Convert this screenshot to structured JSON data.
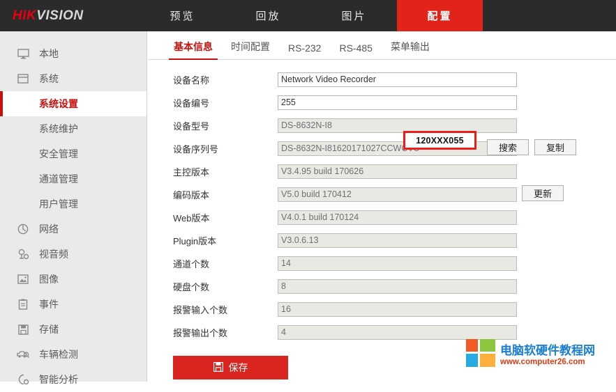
{
  "header": {
    "logo_hik": "HIK",
    "logo_vision": "VISION",
    "nav": [
      {
        "label": "预览",
        "name": "nav-preview",
        "active": false
      },
      {
        "label": "回放",
        "name": "nav-playback",
        "active": false
      },
      {
        "label": "图片",
        "name": "nav-picture",
        "active": false
      },
      {
        "label": "配置",
        "name": "nav-configuration",
        "active": true
      }
    ]
  },
  "sidebar": {
    "items": [
      {
        "label": "本地",
        "icon": "monitor-icon",
        "name": "sidebar-item-local",
        "sub": false,
        "active": false
      },
      {
        "label": "系统",
        "icon": "window-icon",
        "name": "sidebar-item-system",
        "sub": false,
        "active": false
      },
      {
        "label": "系统设置",
        "icon": "",
        "name": "sidebar-item-system-settings",
        "sub": true,
        "active": true
      },
      {
        "label": "系统维护",
        "icon": "",
        "name": "sidebar-item-system-maintenance",
        "sub": true,
        "active": false
      },
      {
        "label": "安全管理",
        "icon": "",
        "name": "sidebar-item-security-management",
        "sub": true,
        "active": false
      },
      {
        "label": "通道管理",
        "icon": "",
        "name": "sidebar-item-channel-management",
        "sub": true,
        "active": false
      },
      {
        "label": "用户管理",
        "icon": "",
        "name": "sidebar-item-user-management",
        "sub": true,
        "active": false
      },
      {
        "label": "网络",
        "icon": "globe-icon",
        "name": "sidebar-item-network",
        "sub": false,
        "active": false
      },
      {
        "label": "视音频",
        "icon": "video-audio-icon",
        "name": "sidebar-item-video-audio",
        "sub": false,
        "active": false
      },
      {
        "label": "图像",
        "icon": "image-icon",
        "name": "sidebar-item-image",
        "sub": false,
        "active": false
      },
      {
        "label": "事件",
        "icon": "clipboard-icon",
        "name": "sidebar-item-event",
        "sub": false,
        "active": false
      },
      {
        "label": "存储",
        "icon": "save-disk-icon",
        "name": "sidebar-item-storage",
        "sub": false,
        "active": false
      },
      {
        "label": "车辆检测",
        "icon": "vehicle-detect-icon",
        "name": "sidebar-item-vehicle-detection",
        "sub": false,
        "active": false
      },
      {
        "label": "智能分析",
        "icon": "smart-analysis-icon",
        "name": "sidebar-item-smart-analysis",
        "sub": false,
        "active": false
      }
    ]
  },
  "tabs": [
    {
      "label": "基本信息",
      "name": "tab-basic-info",
      "active": true
    },
    {
      "label": "时间配置",
      "name": "tab-time-config",
      "active": false
    },
    {
      "label": "RS-232",
      "name": "tab-rs232",
      "active": false
    },
    {
      "label": "RS-485",
      "name": "tab-rs485",
      "active": false
    },
    {
      "label": "菜单输出",
      "name": "tab-menu-output",
      "active": false
    }
  ],
  "form": {
    "rows": [
      {
        "label": "设备名称",
        "value": "Network Video Recorder",
        "readonly": false,
        "name": "device-name"
      },
      {
        "label": "设备编号",
        "value": "255",
        "readonly": false,
        "name": "device-number"
      },
      {
        "label": "设备型号",
        "value": "DS-8632N-I8",
        "readonly": true,
        "name": "device-model"
      },
      {
        "label": "设备序列号",
        "value": "DS-8632N-I81620171027CCWCVU",
        "readonly": true,
        "name": "device-serial-number"
      },
      {
        "label": "主控版本",
        "value": "V3.4.95 build 170626",
        "readonly": true,
        "name": "firmware-version"
      },
      {
        "label": "编码版本",
        "value": "V5.0 build 170412",
        "readonly": true,
        "name": "encoding-version"
      },
      {
        "label": "Web版本",
        "value": "V4.0.1 build 170124",
        "readonly": true,
        "name": "web-version"
      },
      {
        "label": "Plugin版本",
        "value": "V3.0.6.13",
        "readonly": true,
        "name": "plugin-version"
      },
      {
        "label": "通道个数",
        "value": "14",
        "readonly": true,
        "name": "channel-count"
      },
      {
        "label": "硬盘个数",
        "value": "8",
        "readonly": true,
        "name": "hdd-count"
      },
      {
        "label": "报警输入个数",
        "value": "16",
        "readonly": true,
        "name": "alarm-input-count"
      },
      {
        "label": "报警输出个数",
        "value": "4",
        "readonly": true,
        "name": "alarm-output-count"
      }
    ],
    "search_button": "搜索",
    "copy_button": "复制",
    "update_button": "更新",
    "save_button": "保存",
    "save_icon": "floppy-disk-icon"
  },
  "annotation": {
    "redbox_text": "120XXX055"
  },
  "watermark": {
    "title": "电脑软硬件教程网",
    "url": "www.computer26.com",
    "colors": [
      "#f15a24",
      "#8cc63e",
      "#29abe2",
      "#fbb03b"
    ]
  },
  "colors": {
    "brand_red": "#e2231a",
    "active_red": "#c8100f",
    "topbar_bg": "#2b2b2b",
    "sidebar_bg": "#eaeaea"
  }
}
